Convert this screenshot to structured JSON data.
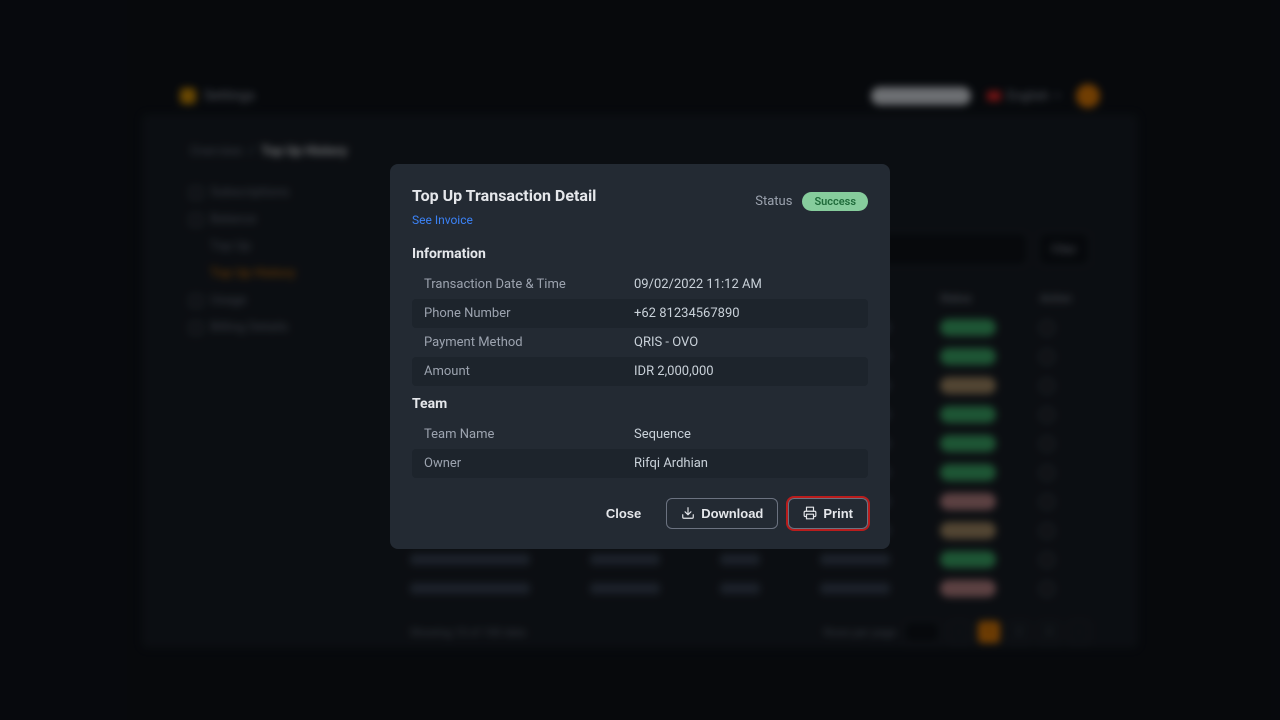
{
  "topbar": {
    "brand": "Settings",
    "language": "English"
  },
  "breadcrumbs": {
    "parent": "Overview",
    "current": "Top Up History"
  },
  "sidebar": {
    "items": [
      {
        "label": "Subscriptions"
      },
      {
        "label": "Balance"
      },
      {
        "label": "Top Up"
      },
      {
        "label": "Top Up History"
      },
      {
        "label": "Usage"
      },
      {
        "label": "Billing Details"
      }
    ]
  },
  "table": {
    "headers": {
      "status": "Status",
      "action": "Action"
    },
    "footer": {
      "summary": "Showing 10 of 100 data",
      "rows_label": "Rows per page"
    }
  },
  "modal": {
    "title": "Top Up Transaction Detail",
    "see_invoice": "See Invoice",
    "status_label": "Status",
    "status_value": "Success",
    "sections": {
      "information": {
        "title": "Information",
        "rows": {
          "datetime_label": "Transaction Date & Time",
          "datetime_value": "09/02/2022 11:12 AM",
          "phone_label": "Phone Number",
          "phone_value": "+62 81234567890",
          "payment_label": "Payment Method",
          "payment_value": "QRIS - OVO",
          "amount_label": "Amount",
          "amount_value": "IDR 2,000,000"
        }
      },
      "team": {
        "title": "Team",
        "rows": {
          "team_name_label": "Team Name",
          "team_name_value": "Sequence",
          "owner_label": "Owner",
          "owner_value": "Rifqi Ardhian"
        }
      }
    },
    "actions": {
      "close": "Close",
      "download": "Download",
      "print": "Print"
    }
  }
}
